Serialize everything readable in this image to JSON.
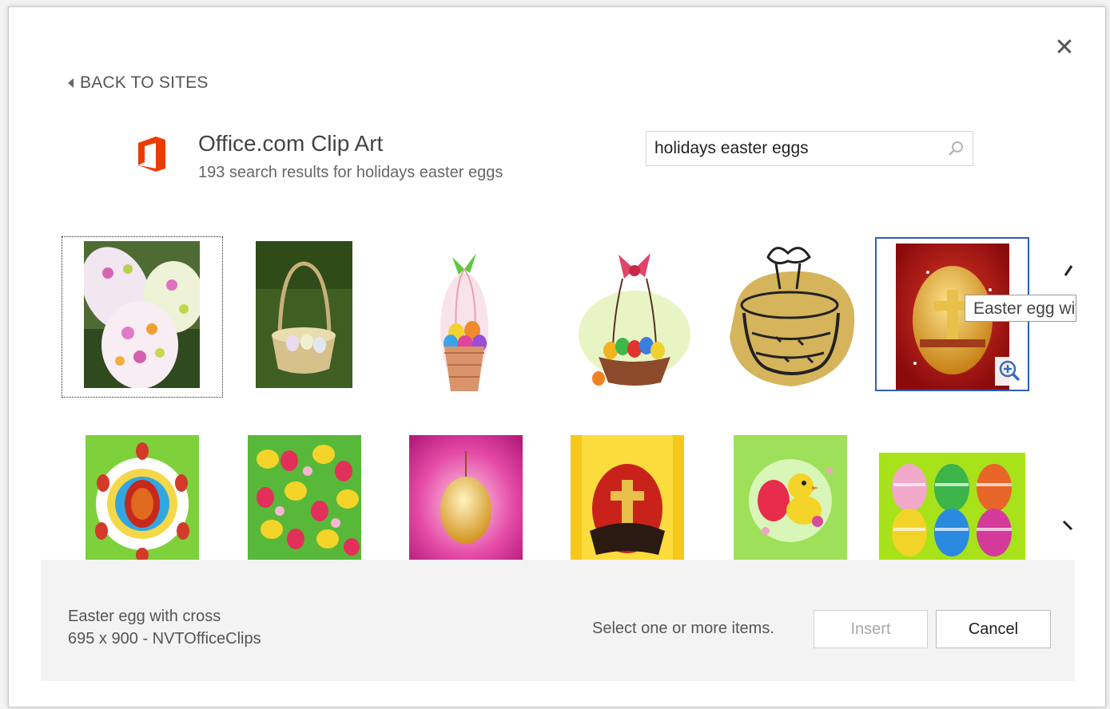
{
  "dialog": {
    "close_glyph": "✕",
    "back_label": "BACK TO SITES"
  },
  "site": {
    "title": "Office.com Clip Art",
    "subtitle": "193 search results for holidays easter eggs",
    "logo_color": "#eb3c00"
  },
  "search": {
    "value": "holidays easter eggs",
    "icon": "search-icon"
  },
  "results": {
    "row1": [
      {
        "name": "result-tile-eggs-photo",
        "icon": "easter-eggs-in-grass-photo"
      },
      {
        "name": "result-tile-basket-photo",
        "icon": "basket-in-grass-photo"
      },
      {
        "name": "result-tile-basket-bow",
        "icon": "easter-basket-green-bow-clipart"
      },
      {
        "name": "result-tile-basket-red-bow",
        "icon": "easter-basket-red-bow-clipart"
      },
      {
        "name": "result-tile-gold-basket",
        "icon": "gold-basket-clipart"
      },
      {
        "name": "result-tile-egg-cross",
        "icon": "easter-egg-with-cross"
      }
    ],
    "row2": [
      {
        "name": "result-tile-egg-mandala",
        "icon": "egg-mandala"
      },
      {
        "name": "result-tile-chick-pattern",
        "icon": "chick-pattern"
      },
      {
        "name": "result-tile-gold-egg-pink",
        "icon": "gold-egg-pink-burst"
      },
      {
        "name": "result-tile-happy-easter",
        "icon": "happy-easter-egg"
      },
      {
        "name": "result-tile-chick-egg",
        "icon": "chick-with-egg"
      },
      {
        "name": "result-tile-colorful-eggs",
        "icon": "six-colorful-eggs"
      }
    ],
    "tooltip": "Easter egg with cross",
    "selected_index": 5,
    "colors": {
      "selection_border": "#2e5db8"
    }
  },
  "footer": {
    "item_name": "Easter egg with cross",
    "item_meta": "695 x 900 - NVTOfficeClips",
    "hint": "Select one or more items.",
    "insert_label": "Insert",
    "cancel_label": "Cancel"
  }
}
